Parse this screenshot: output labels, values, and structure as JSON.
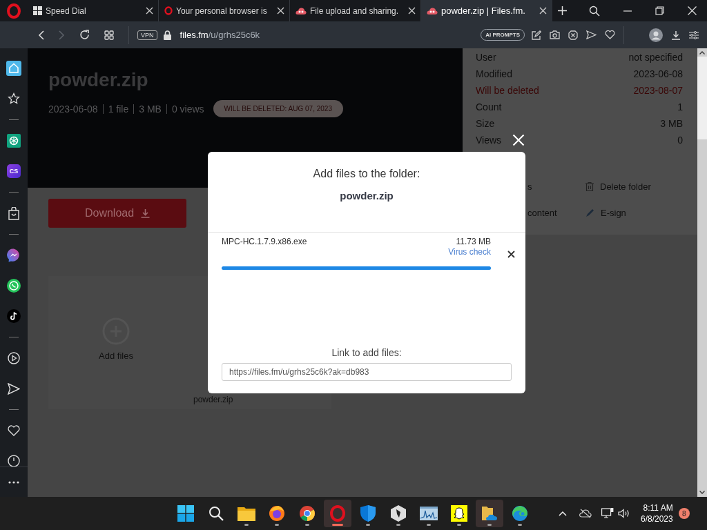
{
  "browser": {
    "tabs": [
      {
        "kind": "speed-dial",
        "title": "Speed Dial",
        "selected": false
      },
      {
        "kind": "opera",
        "title": "Your personal browser is",
        "selected": false
      },
      {
        "kind": "filesfm",
        "title": "File upload and sharing.",
        "selected": false
      },
      {
        "kind": "filesfm",
        "title": "powder.zip | Files.fm.",
        "selected": true
      }
    ],
    "toolbar": {
      "forward_disabled": true,
      "vpn": "VPN",
      "url_host": "files.fm",
      "url_path": "/u/grhs25c6k",
      "ai_button": "AI PROMPTS"
    },
    "sidebar": {
      "groups": [
        {
          "items": [
            {
              "kind": "home"
            },
            {
              "kind": "star"
            }
          ]
        },
        {
          "items": [
            {
              "kind": "chatgpt"
            },
            {
              "kind": "cs",
              "label": "CS"
            }
          ]
        },
        {
          "items": [
            {
              "kind": "bag"
            }
          ]
        },
        {
          "items": [
            {
              "kind": "messenger"
            },
            {
              "kind": "whatsapp"
            },
            {
              "kind": "tiktok"
            }
          ]
        },
        {
          "items": [
            {
              "kind": "play"
            },
            {
              "kind": "send"
            }
          ]
        },
        {
          "items": [
            {
              "kind": "heart"
            },
            {
              "kind": "clock"
            }
          ]
        }
      ]
    }
  },
  "page": {
    "title": "powder.zip",
    "meta": [
      "2023-06-08",
      "1 file",
      "3 MB",
      "0 views"
    ],
    "deletion_badge": "WILL BE DELETED: AUG 07, 2023",
    "download_button": "Download",
    "add_files": "Add files",
    "file_name": "powder.zip",
    "details": [
      {
        "label": "User",
        "value": "not specified",
        "kind": "normal"
      },
      {
        "label": "Modified",
        "value": "2023-06-08",
        "kind": "normal"
      },
      {
        "label": "Will be deleted",
        "value": "2023-08-07",
        "kind": "warning"
      },
      {
        "label": "Count",
        "value": "1",
        "kind": "normal"
      },
      {
        "label": "Size",
        "value": "3 MB",
        "kind": "normal"
      },
      {
        "label": "Views",
        "value": "0",
        "kind": "normal"
      }
    ],
    "actions": [
      {
        "kind": "partial",
        "label": "s"
      },
      {
        "kind": "trash",
        "label": "Delete folder"
      },
      {
        "kind": "partial",
        "label": "content"
      },
      {
        "kind": "pen",
        "label": "E-sign"
      }
    ]
  },
  "dialog": {
    "title": "Add files to the folder:",
    "folder": "powder.zip",
    "files": [
      {
        "name": "MPC-HC.1.7.9.x86.exe",
        "size": "11.73 MB",
        "link": "Virus check",
        "level": 1
      }
    ],
    "link_label": "Link to add files:",
    "link_value": "https://files.fm/u/grhs25c6k?ak=db983"
  },
  "taskbar": {
    "apps": [
      {
        "kind": "windows",
        "running": false,
        "active": false
      },
      {
        "kind": "search",
        "running": false,
        "active": false
      },
      {
        "kind": "folder",
        "running": true,
        "active": false
      },
      {
        "kind": "firefox",
        "running": true,
        "active": false
      },
      {
        "kind": "chrome",
        "running": true,
        "active": false
      },
      {
        "kind": "opera",
        "running": true,
        "active": true
      },
      {
        "kind": "shield",
        "running": true,
        "active": false
      },
      {
        "kind": "cube",
        "running": true,
        "active": false
      },
      {
        "kind": "monitor",
        "running": true,
        "active": false
      },
      {
        "kind": "snapchat",
        "running": true,
        "active": false
      },
      {
        "kind": "files",
        "running": true,
        "active": true
      },
      {
        "kind": "edge",
        "running": true,
        "active": false
      }
    ],
    "time": "8:11 AM",
    "date": "6/8/2023",
    "notifications": "8"
  }
}
